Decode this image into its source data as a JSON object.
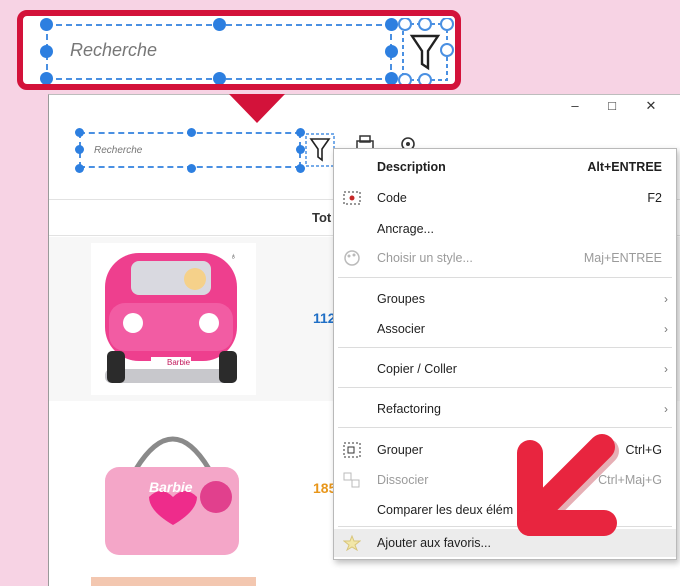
{
  "search": {
    "placeholder": "Recherche"
  },
  "window": {
    "minimize": "–",
    "maximize": "□",
    "close": "✕"
  },
  "table": {
    "header_partial": "Tot",
    "rows": [
      {
        "price_partial": "112",
        "price_color": "#1f6fc6"
      },
      {
        "price_partial": "185",
        "price_color": "#e8961a"
      }
    ]
  },
  "menu": {
    "items": [
      {
        "label": "Description",
        "shortcut": "Alt+ENTREE"
      },
      {
        "label": "Code",
        "shortcut": "F2"
      },
      {
        "label": "Ancrage..."
      },
      {
        "label": "Choisir un style...",
        "shortcut": "Maj+ENTREE"
      },
      {
        "label": "Groupes"
      },
      {
        "label": "Associer"
      },
      {
        "label": "Copier / Coller"
      },
      {
        "label": "Refactoring"
      },
      {
        "label": "Grouper",
        "shortcut": "Ctrl+G"
      },
      {
        "label": "Dissocier",
        "shortcut": "Ctrl+Maj+G"
      },
      {
        "label": "Comparer les deux élém"
      },
      {
        "label": "Ajouter aux favoris..."
      }
    ]
  },
  "products": [
    {
      "name": "Barbie",
      "badge": "♁"
    },
    {
      "name": "Barbie"
    }
  ],
  "colors": {
    "accent": "#d3123a",
    "selection": "#2d7fe0",
    "arrow": "#e8253f"
  }
}
